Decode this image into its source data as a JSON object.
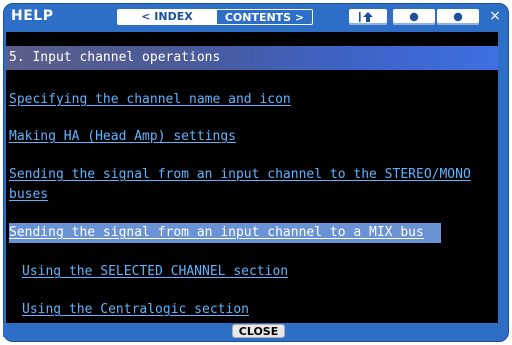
{
  "window": {
    "title": "HELP",
    "close_glyph": "×"
  },
  "tabs": {
    "index_label": "< INDEX",
    "contents_label": "CONTENTS >"
  },
  "toolbar": {
    "up_icon": "up-arrow-icon",
    "prev_icon": "back-icon",
    "next_icon": "forward-icon"
  },
  "section": {
    "title": "5. Input channel operations"
  },
  "links": [
    "Specifying the channel name and icon",
    "Making HA (Head Amp) settings",
    "Sending the signal from an input channel to the STEREO/MONO",
    "buses",
    "Sending the signal from an input channel to a MIX bus",
    "Using the SELECTED CHANNEL section",
    "Using the Centralogic section"
  ],
  "footer": {
    "close_label": "CLOSE"
  },
  "colors": {
    "frame": "#2d6fc7",
    "link": "#5fb3ff",
    "selected": "#6a93d6",
    "background": "#000000"
  }
}
